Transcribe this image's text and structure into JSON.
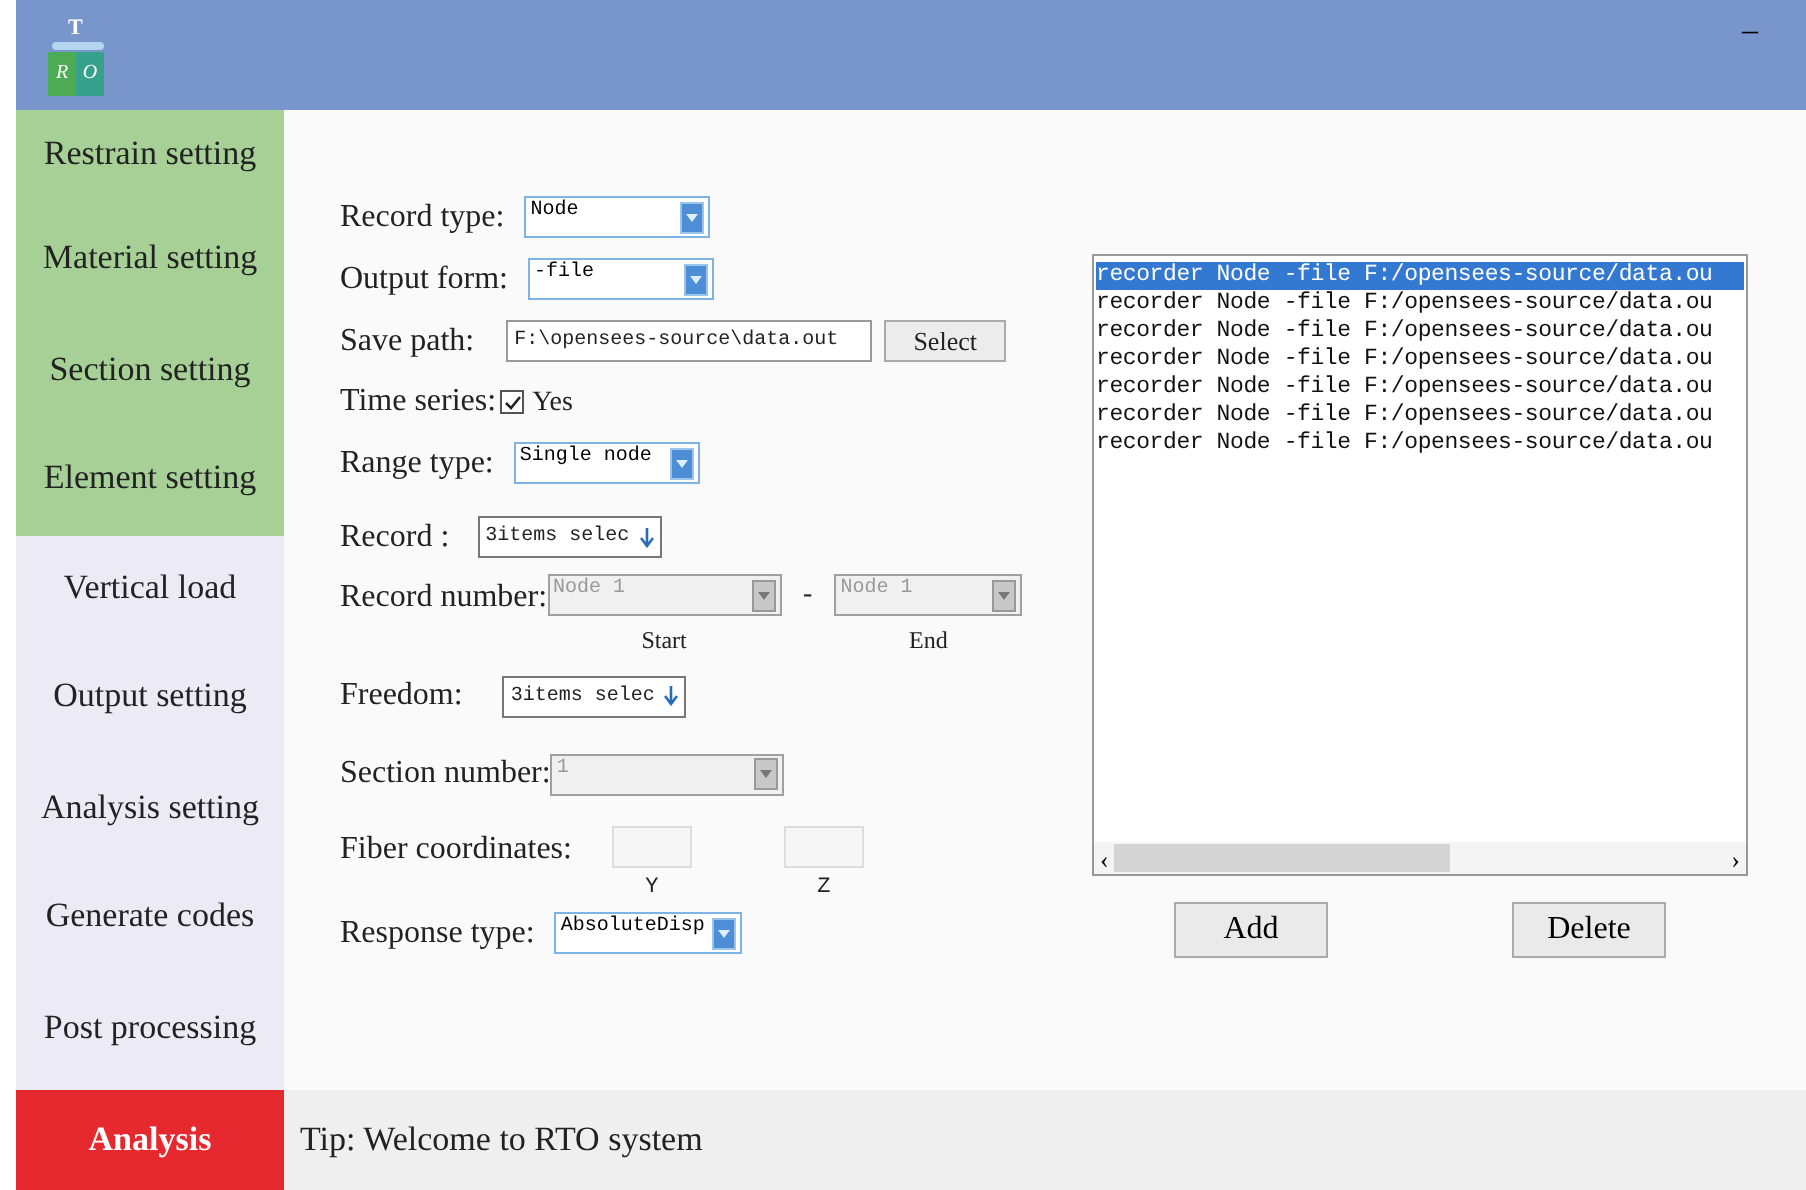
{
  "title_bar": {
    "logo_letters": [
      "T",
      "R",
      "O"
    ],
    "minimize": "–"
  },
  "sidebar": {
    "items": [
      {
        "label": "Restrain setting",
        "color": "#a6d096"
      },
      {
        "label": "Material setting",
        "color": "#a6d096"
      },
      {
        "label": "Section setting",
        "color": "#a6d096"
      },
      {
        "label": "Element setting",
        "color": "#a6d096"
      },
      {
        "label": "Vertical load",
        "color": "#eceaf4"
      },
      {
        "label": "Output setting",
        "color": "#eceaf4"
      },
      {
        "label": "Analysis setting",
        "color": "#eceaf4"
      },
      {
        "label": "Generate codes",
        "color": "#eceaf4"
      },
      {
        "label": "Post processing",
        "color": "#eceaf4"
      },
      {
        "label": "Analysis",
        "color": "#e5292f"
      }
    ]
  },
  "form": {
    "rows": [
      {
        "kind": "combo",
        "label": "Record type:",
        "value": "Node"
      },
      {
        "kind": "combo",
        "label": "Output form:",
        "value": "-file"
      },
      {
        "kind": "path",
        "label": "Save path:",
        "value": "F:\\opensees-source\\data.out",
        "button": "Select"
      },
      {
        "kind": "checkbox",
        "label": "Time series:",
        "checked": true,
        "option": "Yes"
      },
      {
        "kind": "combo",
        "label": "Range type:",
        "value": "Single node"
      },
      {
        "kind": "multi",
        "label": "Record :",
        "value": "3items selec"
      },
      {
        "kind": "range",
        "label": "Record number:",
        "separator": "-",
        "fields": [
          {
            "value": "Node 1",
            "caption": "Start"
          },
          {
            "value": "Node 1",
            "caption": "End"
          }
        ]
      },
      {
        "kind": "multi",
        "label": "Freedom:",
        "value": "3items selec"
      },
      {
        "kind": "disabled",
        "label": "Section number:",
        "value": "1"
      },
      {
        "kind": "coords",
        "label": "Fiber coordinates:",
        "fields": [
          {
            "caption": "Y"
          },
          {
            "caption": "Z"
          }
        ]
      },
      {
        "kind": "combo",
        "label": "Response type:",
        "value": "AbsoluteDisp"
      }
    ]
  },
  "command_list": {
    "items": [
      {
        "text": "recorder Node -file F:/opensees-source/data.ou",
        "selected": true
      },
      {
        "text": "recorder Node -file F:/opensees-source/data.ou",
        "selected": false
      },
      {
        "text": "recorder Node -file F:/opensees-source/data.ou",
        "selected": false
      },
      {
        "text": "recorder Node -file F:/opensees-source/data.ou",
        "selected": false
      },
      {
        "text": "recorder Node -file F:/opensees-source/data.ou",
        "selected": false
      },
      {
        "text": "recorder Node -file F:/opensees-source/data.ou",
        "selected": false
      },
      {
        "text": "recorder Node -file F:/opensees-source/data.ou",
        "selected": false
      }
    ],
    "scroll_left": "‹",
    "scroll_right": "›"
  },
  "buttons": [
    "Add",
    "Delete"
  ],
  "status_bar": {
    "tip": "Tip: Welcome to RTO system"
  }
}
